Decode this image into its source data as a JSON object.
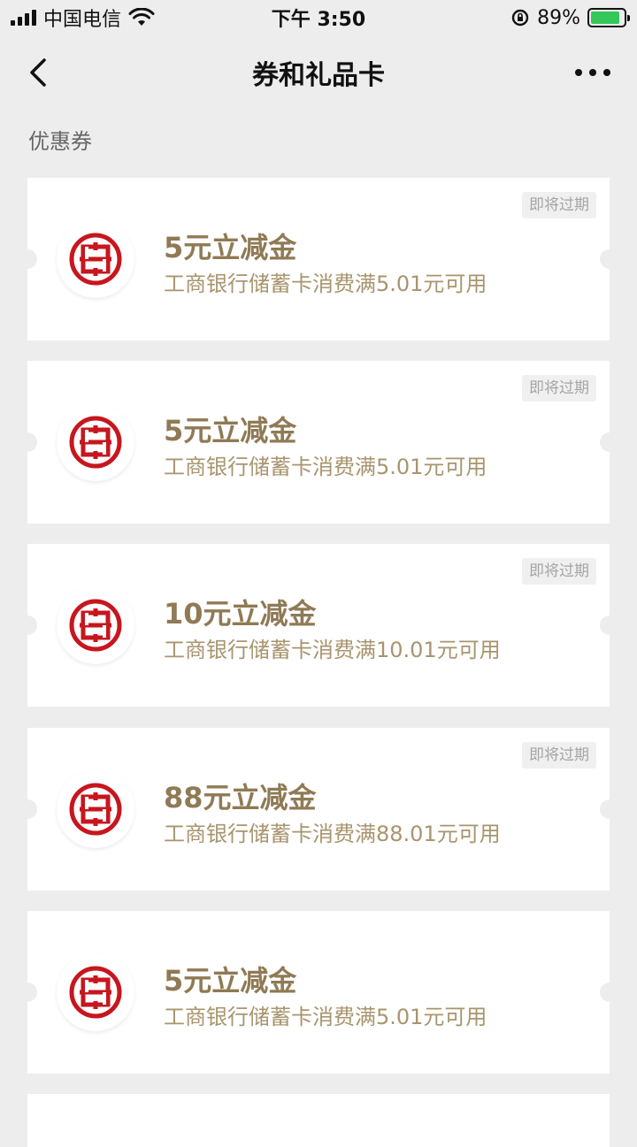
{
  "status": {
    "carrier": "中国电信",
    "time": "下午 3:50",
    "battery": "89%",
    "battery_level": 0.89
  },
  "nav": {
    "title": "券和礼品卡"
  },
  "section": {
    "label": "优惠券"
  },
  "coupons": [
    {
      "title": "5元立减金",
      "desc": "工商银行储蓄卡消费满5.01元可用",
      "badge": "即将过期"
    },
    {
      "title": "5元立减金",
      "desc": "工商银行储蓄卡消费满5.01元可用",
      "badge": "即将过期"
    },
    {
      "title": "10元立减金",
      "desc": "工商银行储蓄卡消费满10.01元可用",
      "badge": "即将过期"
    },
    {
      "title": "88元立减金",
      "desc": "工商银行储蓄卡消费满88.01元可用",
      "badge": "即将过期"
    },
    {
      "title": "5元立减金",
      "desc": "工商银行储蓄卡消费满5.01元可用",
      "badge": ""
    }
  ],
  "colors": {
    "accent_gold": "#8f7a55",
    "bank_red": "#c7161e",
    "background": "#ededed"
  },
  "icons": {
    "bank_logo": "icbc-logo-icon",
    "back": "chevron-left-icon",
    "more": "more-dots-icon"
  }
}
